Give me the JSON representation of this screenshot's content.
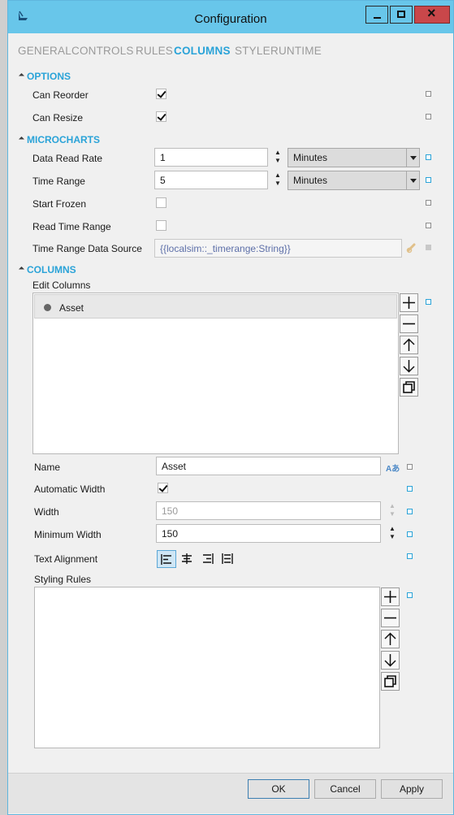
{
  "window": {
    "title": "Configuration"
  },
  "tabs": [
    "GENERAL",
    "CONTROLS",
    "RULES",
    "COLUMNS",
    "STYLE",
    "RUNTIME"
  ],
  "options": {
    "header": "OPTIONS",
    "can_reorder_label": "Can Reorder",
    "can_resize_label": "Can Resize"
  },
  "microcharts": {
    "header": "MICROCHARTS",
    "data_read_rate_label": "Data Read Rate",
    "data_read_rate_value": "1",
    "data_read_rate_unit": "Minutes",
    "time_range_label": "Time Range",
    "time_range_value": "5",
    "time_range_unit": "Minutes",
    "start_frozen_label": "Start Frozen",
    "read_time_range_label": "Read Time Range",
    "time_range_source_label": "Time Range Data Source",
    "time_range_source_value": "{{localsim::_timerange:String}}"
  },
  "columns": {
    "header": "COLUMNS",
    "edit_columns_label": "Edit Columns",
    "items": [
      "Asset"
    ],
    "name_label": "Name",
    "name_value": "Asset",
    "automatic_width_label": "Automatic Width",
    "width_label": "Width",
    "width_value": "150",
    "min_width_label": "Minimum Width",
    "min_width_value": "150",
    "text_alignment_label": "Text Alignment",
    "styling_rules_label": "Styling Rules",
    "spellcheck_glyph": "Aあ"
  },
  "buttons": {
    "ok": "OK",
    "cancel": "Cancel",
    "apply": "Apply"
  },
  "colors": {
    "accent": "#2aa3d8",
    "titlebar": "#68c6ea",
    "close": "#c9474a"
  }
}
